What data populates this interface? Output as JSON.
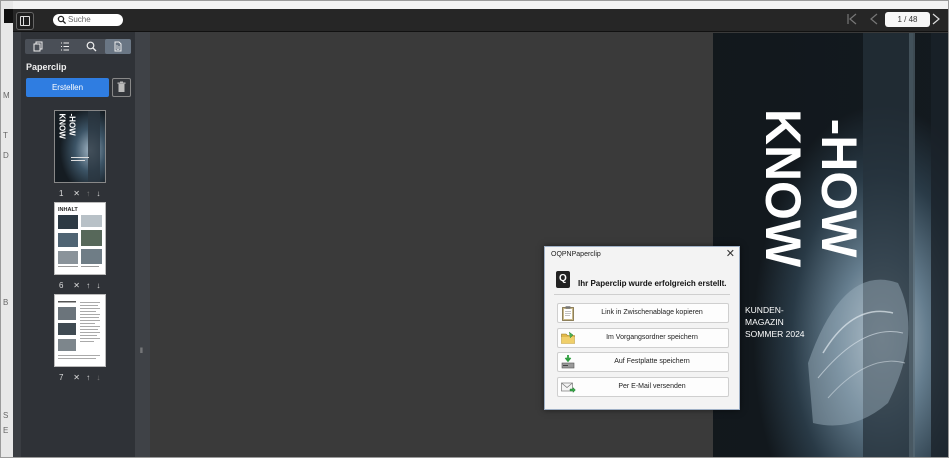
{
  "toolbar": {
    "search_placeholder": "Suche",
    "page_indicator": "1 / 48"
  },
  "sidebar": {
    "title": "Paperclip",
    "create_label": "Erstellen",
    "pages": [
      {
        "number": "1",
        "remove": "✕",
        "up": "↑",
        "down": "↓"
      },
      {
        "number": "6",
        "remove": "✕",
        "up": "↑",
        "down": "↓"
      },
      {
        "number": "7",
        "remove": "✕",
        "up": "↑",
        "down": "↓"
      }
    ],
    "thumb1": {
      "word1": "KNOW",
      "word2": "-HOW"
    },
    "thumb2": {
      "heading": "INHALT"
    }
  },
  "cover": {
    "word1": "KNOW",
    "word2": "-HOW",
    "subtitle_line1": "KUNDEN-",
    "subtitle_line2": "MAGAZIN",
    "subtitle_line3": "SOMMER 2024"
  },
  "dialog": {
    "title": "OQPNPaperclip",
    "logo_letter": "Q",
    "message": "Ihr Paperclip wurde erfolgreich erstellt.",
    "buttons": [
      {
        "label": "Link in Zwischenablage kopieren",
        "icon": "clipboard-icon"
      },
      {
        "label": "Im Vorgangsordner speichern",
        "icon": "folder-icon"
      },
      {
        "label": "Auf Festplatte speichern",
        "icon": "hard-drive-icon"
      },
      {
        "label": "Per E-Mail versenden",
        "icon": "mail-icon"
      }
    ]
  },
  "colors": {
    "accent": "#2f7de1",
    "viewer_bg": "#3a3a3a",
    "sidebar_bg": "#2f3237"
  }
}
